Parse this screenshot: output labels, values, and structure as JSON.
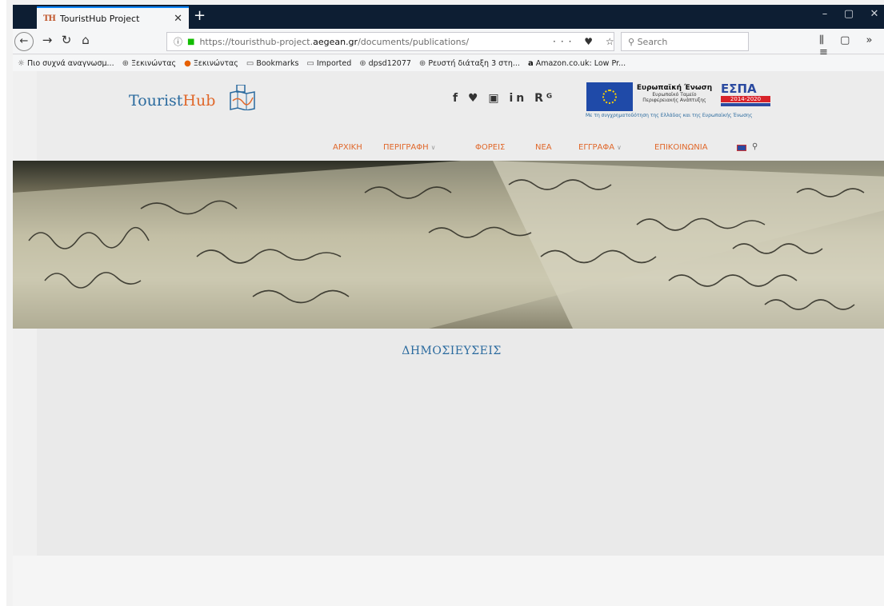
{
  "browser": {
    "tab_title": "TouristHub Project",
    "tab_favicon": "TH",
    "url_prefix": "https://touristhub-project.",
    "url_domain": "aegean.gr",
    "url_path": "/documents/publications/",
    "search_placeholder": "Search",
    "url_actions": "··· ♥ ☆",
    "right_icons": "⫼ ▢ »  ≡"
  },
  "bookmarks": [
    {
      "icon": "gear-icon",
      "label": "Πιο συχνά αναγνωσμ..."
    },
    {
      "icon": "globe-icon",
      "label": "Ξεκινώντας"
    },
    {
      "icon": "firefox-icon",
      "label": "Ξεκινώντας"
    },
    {
      "icon": "folder-icon",
      "label": "Bookmarks"
    },
    {
      "icon": "folder-icon",
      "label": "Imported"
    },
    {
      "icon": "globe-icon",
      "label": "dpsd12077"
    },
    {
      "icon": "globe-icon",
      "label": "Ρευστή διάταξη 3 στη..."
    },
    {
      "icon": "amazon-icon",
      "label": "Amazon.co.uk: Low Pr..."
    }
  ],
  "site": {
    "logo_tourist": "Tourist",
    "logo_hub": "Hub",
    "social": "f ♥ ▣ in Rᴳ",
    "eu_title": "Ευρωπαϊκή Ένωση",
    "eu_sub1": "Ευρωπαϊκό Ταμείο",
    "eu_sub2": "Περιφερειακής Ανάπτυξης",
    "espa_title": "ΕΣΠΑ",
    "espa_years": "2014-2020",
    "cofund": "Με τη συγχρηματοδότηση της Ελλάδας και της Ευρωπαϊκής Ένωσης"
  },
  "menu": [
    {
      "label": "ΑΡΧΙΚΗ",
      "dropdown": false
    },
    {
      "label": "ΠΕΡΙΓΡΑΦΗ",
      "dropdown": true
    },
    {
      "label": "ΦΟΡΕΙΣ",
      "dropdown": false
    },
    {
      "label": "ΝΕΑ",
      "dropdown": false
    },
    {
      "label": "ΕΓΓΡΑΦΑ",
      "dropdown": true
    },
    {
      "label": "ΕΠΙΚΟΙΝΩΝΙΑ",
      "dropdown": false
    }
  ],
  "page_title": "ΔΗΜΟΣΙΕΥΣΕΙΣ"
}
